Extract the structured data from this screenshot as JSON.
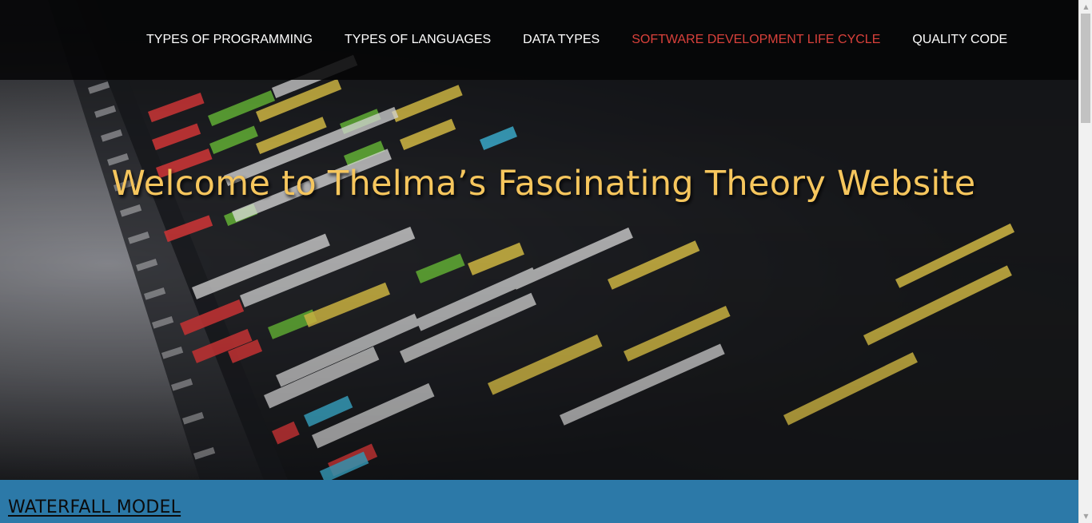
{
  "nav": {
    "items": [
      {
        "label": "TYPES OF PROGRAMMING",
        "active": false
      },
      {
        "label": "TYPES OF LANGUAGES",
        "active": false
      },
      {
        "label": "DATA TYPES",
        "active": false
      },
      {
        "label": "SOFTWARE DEVELOPMENT LIFE CYCLE",
        "active": true
      },
      {
        "label": "QUALITY CODE",
        "active": false
      }
    ]
  },
  "hero": {
    "title": "Welcome to Thelma’s Fascinating Theory Website"
  },
  "section": {
    "heading": "WATERFALL MODEL"
  },
  "colors": {
    "nav_text": "#ffffff",
    "nav_active": "#d9413b",
    "hero_title": "#f6c65d",
    "section_band": "#2c79a8"
  },
  "icons": {
    "scroll_up": "scroll-up-arrow-icon",
    "scroll_down": "scroll-down-arrow-icon"
  }
}
